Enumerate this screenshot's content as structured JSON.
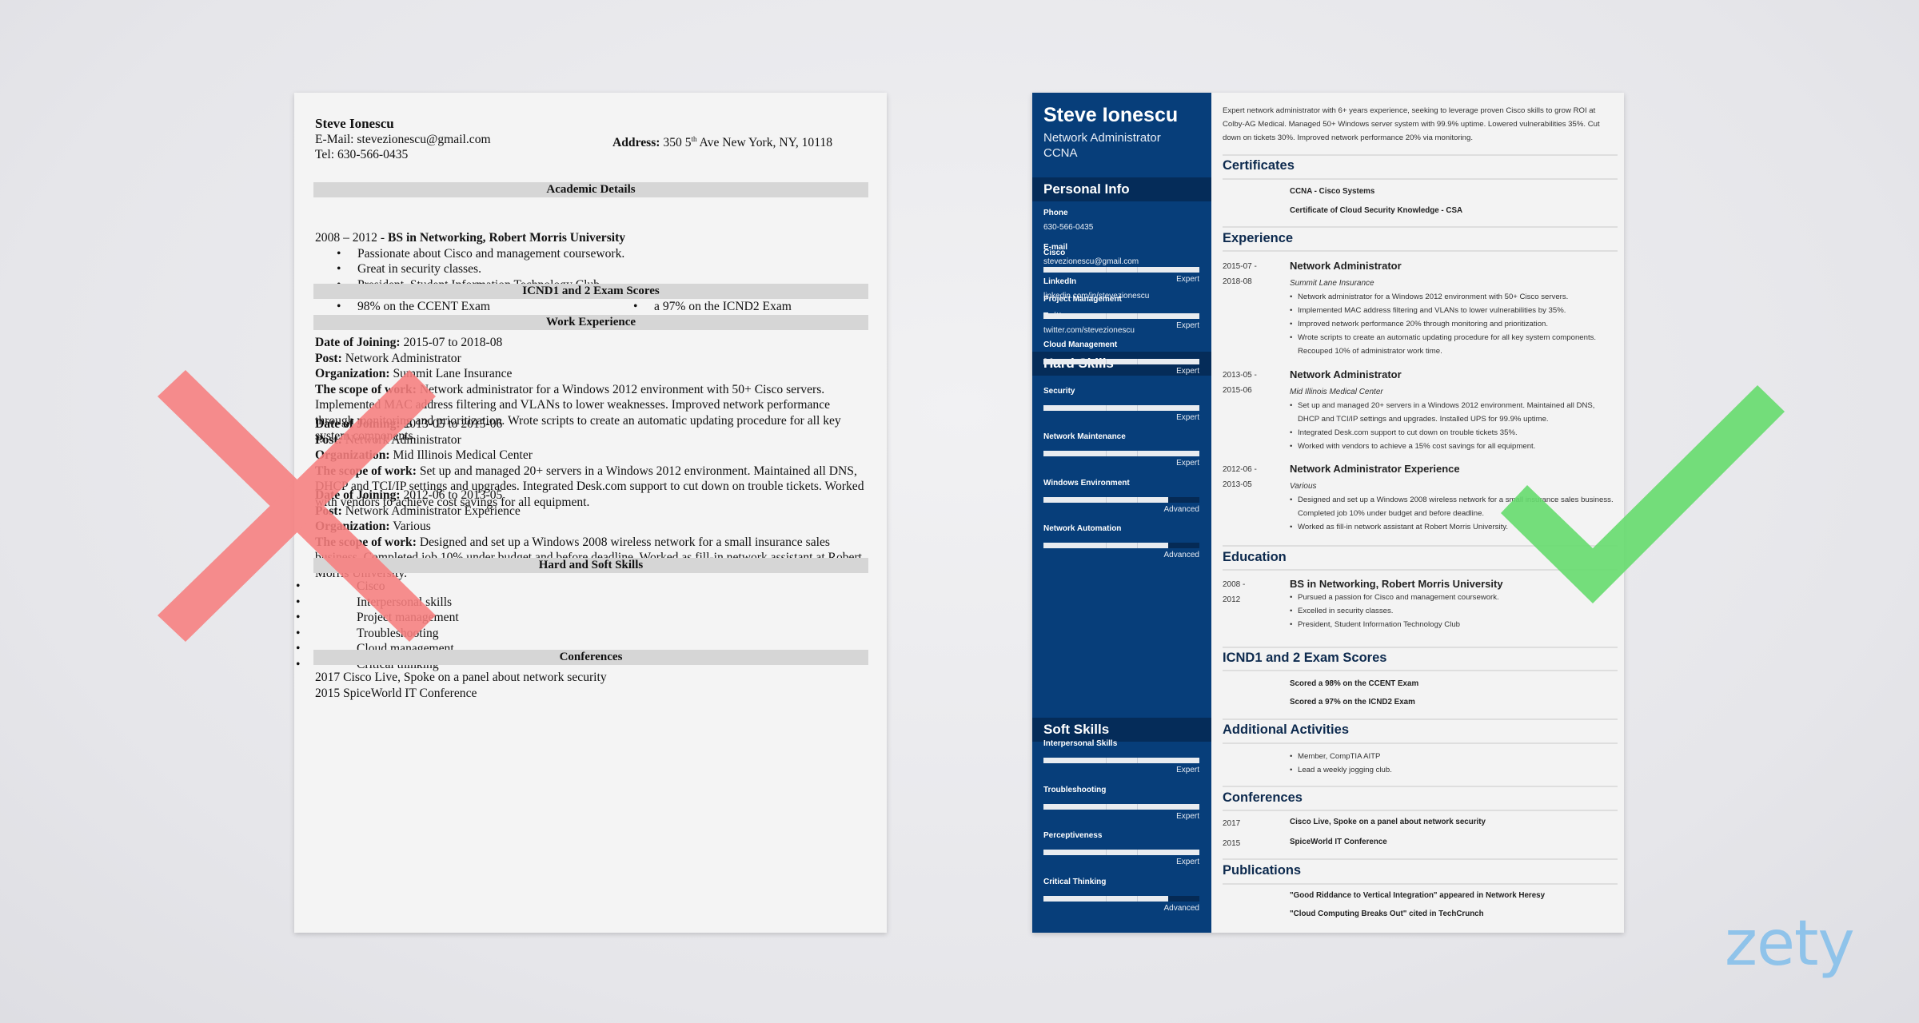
{
  "left_resume": {
    "name": "Steve Ionescu",
    "email_label": "E-Mail:",
    "email": "stevezionescu@gmail.com",
    "tel_label": "Tel:",
    "tel": "630-566-0435",
    "address_label": "Address:",
    "address_prefix": "350 5",
    "address_sup": "th",
    "address_suffix": " Ave New York, NY, 10118",
    "sections": {
      "academic": "Academic Details",
      "exams": "ICND1 and 2 Exam Scores",
      "work": "Work Experience",
      "skills": "Hard and Soft Skills",
      "conferences": "Conferences"
    },
    "education": {
      "years": "2008 – 2012 - ",
      "degree": "BS in Networking, Robert Morris University",
      "bullets": [
        "Passionate about Cisco and management coursework.",
        "Great in security classes.",
        "President, Student Information Technology Club"
      ]
    },
    "exam_scores": [
      "98% on the CCENT Exam",
      "a 97% on the ICND2 Exam"
    ],
    "labels": {
      "date": "Date of Joining:",
      "post": "Post:",
      "org": "Organization:",
      "scope": "The scope of work:"
    },
    "jobs": [
      {
        "date": "2015-07 to 2018-08",
        "post": "Network Administrator",
        "org": "Summit Lane Insurance",
        "scope": "Network administrator for a Windows 2012 environment with 50+ Cisco servers. Implemented MAC address filtering and VLANs to lower weaknesses. Improved network performance through monitoring and prioritization. Wrote scripts to create an automatic updating procedure for all key system components."
      },
      {
        "date": "2013-05 to 2015-06",
        "post": "Network Administrator",
        "org": "Mid Illinois Medical Center",
        "scope": "Set up and managed 20+ servers in a Windows 2012 environment. Maintained all DNS, DHCP and TCI/IP settings and upgrades. Integrated Desk.com support to cut down on trouble tickets. Worked with vendors to achieve cost savings for all equipment."
      },
      {
        "date": "2012-06 to 2013-05",
        "post": "Network Administrator Experience",
        "org": "Various",
        "scope": "Designed and set up a Windows 2008 wireless network for a small insurance sales business. Completed job 10% under budget and before deadline. Worked as fill-in network assistant at Robert Morris University."
      }
    ],
    "skills": [
      "Cisco",
      "Interpersonal skills",
      "Project management",
      "Troubleshooting",
      "Cloud management",
      "Critical thinking"
    ],
    "conferences": [
      "2017 Cisco Live, Spoke on a panel about network security",
      "2015 SpiceWorld IT Conference"
    ]
  },
  "right_resume": {
    "name": "Steve Ionescu",
    "title_line1": "Network Administrator",
    "title_line2": "CCNA",
    "personal_info_title": "Personal Info",
    "personal_info": [
      {
        "label": "Phone",
        "value": "630-566-0435"
      },
      {
        "label": "E-mail",
        "value": "stevezionescu@gmail.com"
      },
      {
        "label": "LinkedIn",
        "value": "linkedin.com/in/stevezionescu"
      },
      {
        "label": "Twitter",
        "value": "twitter.com/stevezionescu"
      }
    ],
    "hard_skills_title": "Hard Skills",
    "hard_skills": [
      {
        "name": "Cisco",
        "level": "Expert",
        "fill": 1.0
      },
      {
        "name": "Project Management",
        "level": "Expert",
        "fill": 1.0
      },
      {
        "name": "Cloud Management",
        "level": "Expert",
        "fill": 1.0
      },
      {
        "name": "Security",
        "level": "Expert",
        "fill": 1.0
      },
      {
        "name": "Network Maintenance",
        "level": "Expert",
        "fill": 1.0
      },
      {
        "name": "Windows Environment",
        "level": "Advanced",
        "fill": 0.8
      },
      {
        "name": "Network Automation",
        "level": "Advanced",
        "fill": 0.8
      }
    ],
    "soft_skills_title": "Soft Skills",
    "soft_skills": [
      {
        "name": "Interpersonal Skills",
        "level": "Expert",
        "fill": 1.0
      },
      {
        "name": "Troubleshooting",
        "level": "Expert",
        "fill": 1.0
      },
      {
        "name": "Perceptiveness",
        "level": "Expert",
        "fill": 1.0
      },
      {
        "name": "Critical Thinking",
        "level": "Advanced",
        "fill": 0.8
      }
    ],
    "summary": "Expert network administrator with 6+ years experience, seeking to leverage proven Cisco skills to grow ROI at Colby-AG Medical. Managed 50+ Windows server system with 99.9% uptime. Lowered vulnerabilities 35%. Cut down on tickets 30%. Improved network performance 20% via monitoring.",
    "sections": {
      "certificates": "Certificates",
      "experience": "Experience",
      "education": "Education",
      "exams": "ICND1 and 2 Exam Scores",
      "activities": "Additional Activities",
      "conferences": "Conferences",
      "publications": "Publications"
    },
    "certificates": [
      "CCNA - Cisco Systems",
      "Certificate of Cloud Security Knowledge - CSA"
    ],
    "experience": [
      {
        "date_start": "2015-07 -",
        "date_end": "2018-08",
        "title": "Network Administrator",
        "org": "Summit Lane Insurance",
        "bullets": [
          "Network administrator for a Windows 2012  environment with 50+ Cisco servers.",
          "Implemented MAC address filtering and VLANs to lower vulnerabilities by 35%.",
          "Improved network performance 20% through monitoring and prioritization.",
          "Wrote scripts to create an automatic updating procedure for all key system components. Recouped 10% of administrator work time."
        ]
      },
      {
        "date_start": "2013-05 -",
        "date_end": "2015-06",
        "title": "Network Administrator",
        "org": "Mid Illinois Medical Center",
        "bullets": [
          "Set up and managed 20+ servers in a Windows 2012 environment. Maintained all DNS, DHCP and TCI/IP settings and upgrades. Installed UPS for 99.9% uptime.",
          "Integrated Desk.com support to cut down on trouble tickets 35%.",
          "Worked with vendors to achieve a 15% cost savings for all equipment."
        ]
      },
      {
        "date_start": "2012-06 -",
        "date_end": "2013-05",
        "title": "Network Administrator Experience",
        "org": "Various",
        "bullets": [
          "Designed and set up a Windows 2008 wireless network for a small insurance sales business. Completed job 10% under budget and before deadline.",
          "Worked as fill-in network assistant at Robert Morris University."
        ]
      }
    ],
    "education": {
      "date_start": "2008 -",
      "date_end": "2012",
      "title": "BS in Networking, Robert Morris University",
      "bullets": [
        "Pursued a passion for Cisco and management coursework.",
        "Excelled in security classes.",
        "President, Student Information Technology Club"
      ]
    },
    "exam_scores": [
      "Scored a 98% on the CCENT Exam",
      "Scored a 97% on the ICND2 Exam"
    ],
    "activities": [
      "Member, CompTIA AITP",
      "Lead a weekly jogging club."
    ],
    "conferences": [
      {
        "year": "2017",
        "text": "Cisco Live, Spoke on a panel about network security"
      },
      {
        "year": "2015",
        "text": "SpiceWorld IT Conference"
      }
    ],
    "publications": [
      "\"Good Riddance to Vertical Integration\" appeared in Network Heresy",
      "\"Cloud Computing Breaks Out\" cited in TechCrunch"
    ]
  },
  "overlays": {
    "bad_mark": "x-mark-icon",
    "good_mark": "check-mark-icon",
    "bad_color": "#f77f7f",
    "good_color": "#66dc6e",
    "sidebar_color": "#073e7a",
    "logo": "zety",
    "logo_color": "#8fc3ea"
  }
}
